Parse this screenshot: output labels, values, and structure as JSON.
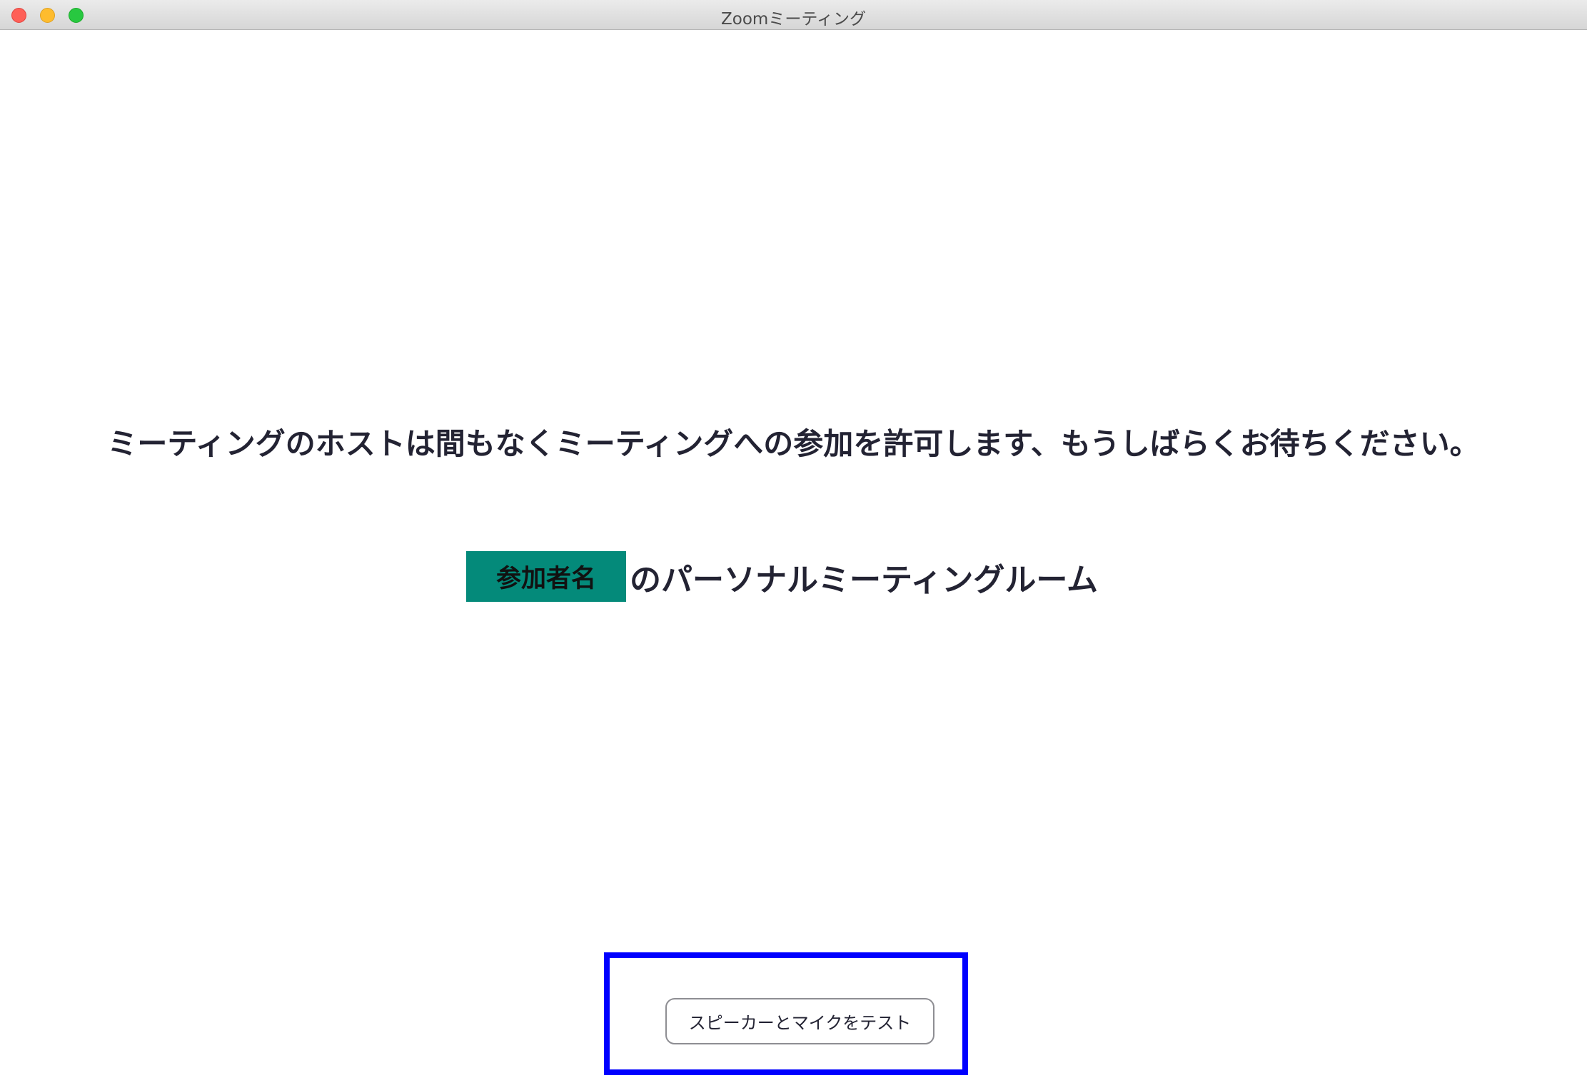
{
  "window": {
    "title": "Zoomミーティング"
  },
  "main": {
    "waiting_message": "ミーティングのホストは間もなくミーティングへの参加を許可します、もうしばらくお待ちください。",
    "participant_name": "参加者名",
    "room_suffix": "のパーソナルミーティングルーム"
  },
  "actions": {
    "test_audio_label": "スピーカーとマイクをテスト"
  },
  "colors": {
    "name_highlight": "#048a7a",
    "annotation_box": "#0000ff"
  }
}
